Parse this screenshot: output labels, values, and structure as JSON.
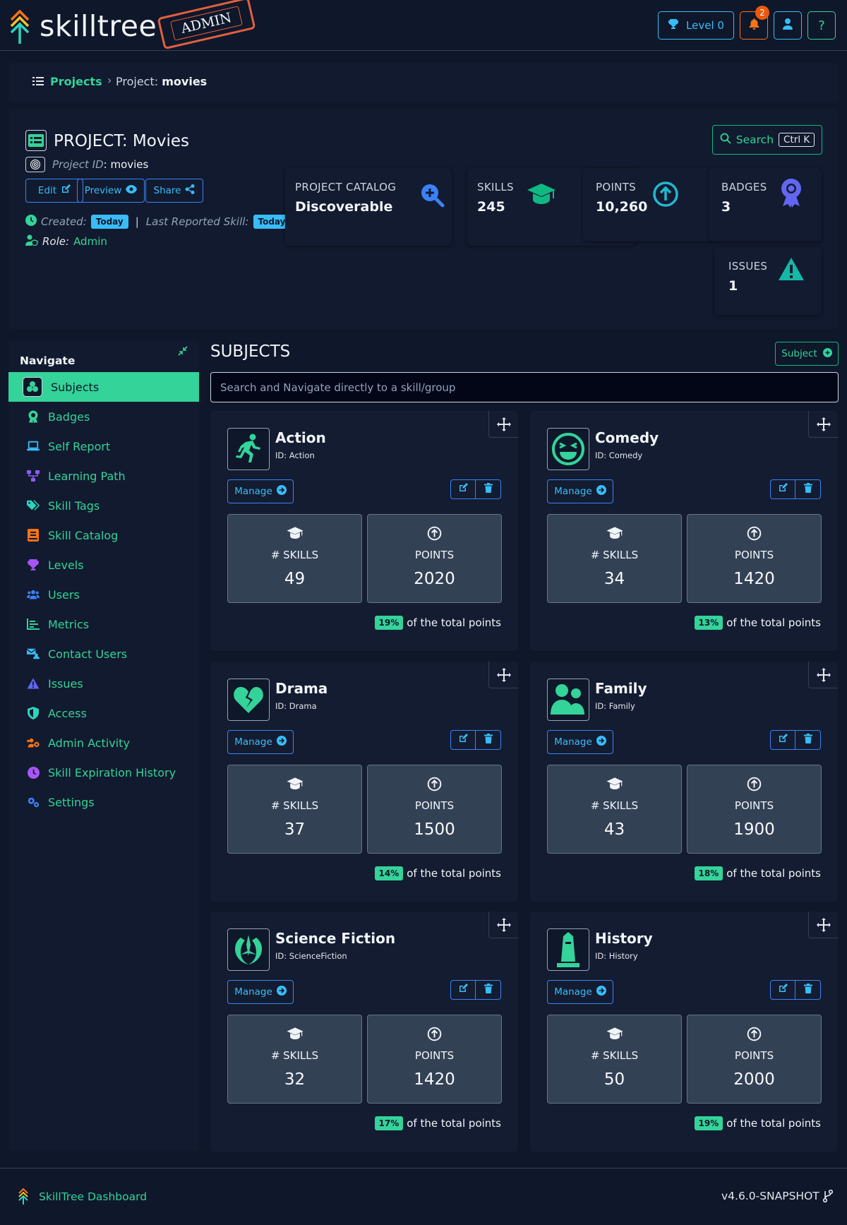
{
  "header": {
    "logo_text": "skilltree",
    "stamp_text": "ADMIN",
    "level_label": "Level 0",
    "notification_count": "2"
  },
  "breadcrumb": {
    "projects_label": "Projects",
    "current_prefix": "Project:",
    "current_name": "movies"
  },
  "project": {
    "title": "PROJECT: Movies",
    "id_label": "Project ID",
    "id_value": ": movies",
    "edit_label": "Edit",
    "preview_label": "Preview",
    "share_label": "Share",
    "created_label": "Created:",
    "created_value": "Today",
    "separator": "|",
    "last_reported_label": "Last Reported Skill:",
    "last_reported_value": "Today",
    "role_label": "Role:",
    "role_value": "Admin",
    "search_label": "Search",
    "search_shortcut": "Ctrl K"
  },
  "stats": {
    "catalog_label": "PROJECT CATALOG",
    "catalog_value": "Discoverable",
    "skills_label": "SKILLS",
    "skills_value": "245",
    "points_label": "POINTS",
    "points_value": "10,260",
    "badges_label": "BADGES",
    "badges_value": "3",
    "issues_label": "ISSUES",
    "issues_value": "1"
  },
  "nav": {
    "title": "Navigate",
    "items": [
      {
        "label": "Subjects",
        "icon": "subjects-icon",
        "color": "#34d399"
      },
      {
        "label": "Badges",
        "icon": "badge-icon",
        "color": "#34d399"
      },
      {
        "label": "Self Report",
        "icon": "laptop-icon",
        "color": "#38bdf8"
      },
      {
        "label": "Learning Path",
        "icon": "network-icon",
        "color": "#8b5cf6"
      },
      {
        "label": "Skill Tags",
        "icon": "tags-icon",
        "color": "#2dd4bf"
      },
      {
        "label": "Skill Catalog",
        "icon": "book-icon",
        "color": "#f97316"
      },
      {
        "label": "Levels",
        "icon": "trophy-icon",
        "color": "#a855f7"
      },
      {
        "label": "Users",
        "icon": "users-icon",
        "color": "#3b82f6"
      },
      {
        "label": "Metrics",
        "icon": "chart-icon",
        "color": "#34d399"
      },
      {
        "label": "Contact Users",
        "icon": "contact-icon",
        "color": "#38bdf8"
      },
      {
        "label": "Issues",
        "icon": "warning-icon",
        "color": "#6366f1"
      },
      {
        "label": "Access",
        "icon": "shield-icon",
        "color": "#2dd4bf"
      },
      {
        "label": "Admin Activity",
        "icon": "users-gear-icon",
        "color": "#f97316"
      },
      {
        "label": "Skill Expiration History",
        "icon": "clock-icon",
        "color": "#a855f7"
      },
      {
        "label": "Settings",
        "icon": "gears-icon",
        "color": "#3b82f6"
      }
    ]
  },
  "subjects": {
    "title": "SUBJECTS",
    "add_label": "Subject",
    "search_placeholder": "Search and Navigate directly to a skill/group",
    "manage_label": "Manage",
    "skills_label": "# SKILLS",
    "points_label": "POINTS",
    "pct_suffix": "of the total points",
    "items": [
      {
        "name": "Action",
        "id": "ID: Action",
        "skills": "49",
        "points": "2020",
        "pct": "19%",
        "icon": "running-icon"
      },
      {
        "name": "Comedy",
        "id": "ID: Comedy",
        "skills": "34",
        "points": "1420",
        "pct": "13%",
        "icon": "laughing-face-icon"
      },
      {
        "name": "Drama",
        "id": "ID: Drama",
        "skills": "37",
        "points": "1500",
        "pct": "14%",
        "icon": "broken-heart-icon"
      },
      {
        "name": "Family",
        "id": "ID: Family",
        "skills": "43",
        "points": "1900",
        "pct": "18%",
        "icon": "family-icon"
      },
      {
        "name": "Science Fiction",
        "id": "ID: ScienceFiction",
        "skills": "32",
        "points": "1420",
        "pct": "17%",
        "icon": "jedi-icon"
      },
      {
        "name": "History",
        "id": "ID: History",
        "skills": "50",
        "points": "2000",
        "pct": "19%",
        "icon": "monument-icon"
      }
    ]
  },
  "footer": {
    "dashboard_label": "SkillTree Dashboard",
    "version": "v4.6.0-SNAPSHOT"
  }
}
